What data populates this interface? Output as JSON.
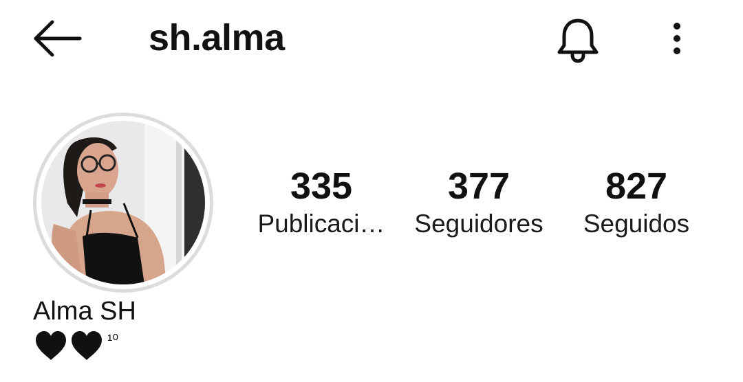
{
  "header": {
    "back_icon": "arrow-left-icon",
    "username": "sh.alma",
    "notification_icon": "bell-icon",
    "more_icon": "more-vertical-icon"
  },
  "profile": {
    "avatar": "profile-photo",
    "full_name": "Alma SH",
    "bio": {
      "hearts": [
        "black-heart-icon",
        "black-heart-icon"
      ],
      "text": "¹⁰"
    }
  },
  "stats": {
    "posts": {
      "count": "335",
      "label": "Publicaci…"
    },
    "followers": {
      "count": "377",
      "label": "Seguidores"
    },
    "following": {
      "count": "827",
      "label": "Seguidos"
    }
  },
  "colors": {
    "text": "#111111",
    "ring": "#dcdcdc",
    "background": "#ffffff"
  }
}
